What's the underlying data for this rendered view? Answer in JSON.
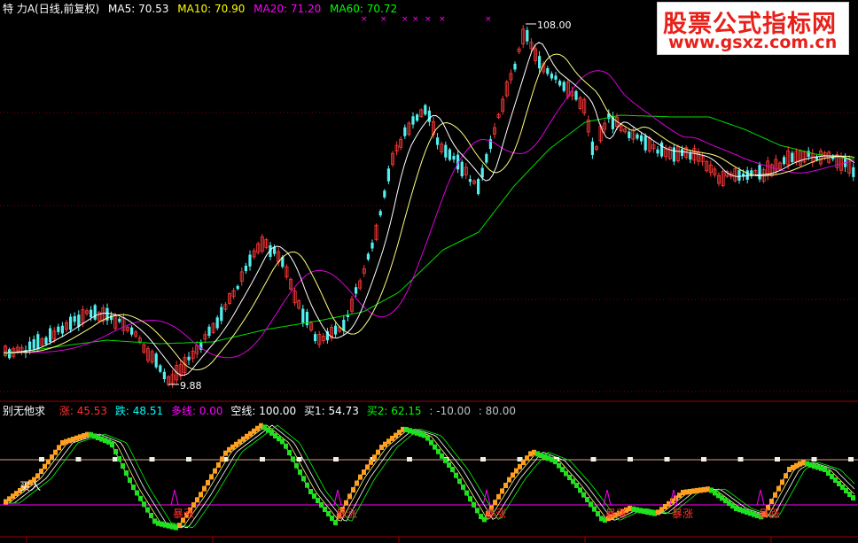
{
  "header": {
    "stock_name": "特 力A",
    "period": "(日线,前复权)",
    "ma": [
      {
        "label": "MA5: 70.53",
        "color": "#ffffff"
      },
      {
        "label": "MA10: 70.90",
        "color": "#ffff00"
      },
      {
        "label": "MA20: 71.20",
        "color": "#ff00ff"
      },
      {
        "label": "MA60: 70.72",
        "color": "#00ff00"
      }
    ]
  },
  "watermark": {
    "title": "股票公式指标网",
    "url": "www.gsxz.com.cn"
  },
  "price_chart": {
    "high_label": "108.00",
    "low_label": "9.88"
  },
  "indicator": {
    "name": "别无他求",
    "values": [
      {
        "label": "涨: 45.53",
        "color": "#ff3030"
      },
      {
        "label": "跌: 48.51",
        "color": "#00ffff"
      },
      {
        "label": "多线: 0.00",
        "color": "#ff00ff"
      },
      {
        "label": "空线: 100.00",
        "color": "#ffffff"
      },
      {
        "label": "买1: 54.73",
        "color": "#ffffff"
      },
      {
        "label": "买2: 62.15",
        "color": "#00ff00"
      },
      {
        "label": ": -10.00",
        "color": "#c0c0c0"
      },
      {
        "label": ": 80.00",
        "color": "#c0c0c0"
      }
    ],
    "buy_label": "买入",
    "surge_label": "暴涨",
    "surge_count": 6
  }
}
